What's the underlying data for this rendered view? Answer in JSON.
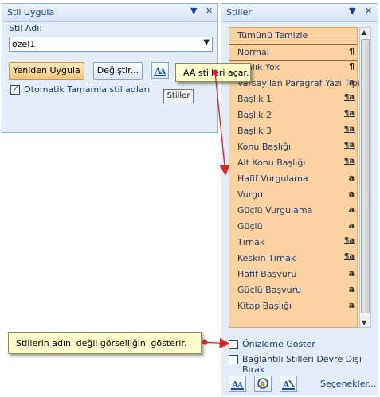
{
  "left_pane": {
    "title": "Stil Uygula",
    "style_name_label": "Stil Adı:",
    "style_name_value": "özel1",
    "reapply_button": "Yeniden Uygula",
    "modify_button": "Değiştir...",
    "autocomplete_label": "Otomatik Tamamla stil adları",
    "autocomplete_checked": true,
    "tooltip": "Stiller"
  },
  "right_pane": {
    "title": "Stiller",
    "styles": [
      {
        "label": "Tümünü Temizle",
        "mark": ""
      },
      {
        "label": "Normal",
        "mark": "¶"
      },
      {
        "label": "Aralık Yok",
        "mark": "¶"
      },
      {
        "label": "Varsayılan Paragraf Yazı Tipi",
        "mark": "a"
      },
      {
        "label": "Başlık 1",
        "mark": "¶a"
      },
      {
        "label": "Başlık 2",
        "mark": "¶a"
      },
      {
        "label": "Başlık 3",
        "mark": "¶a"
      },
      {
        "label": "Konu Başlığı",
        "mark": "¶a"
      },
      {
        "label": "Alt Konu Başlığı",
        "mark": "¶a"
      },
      {
        "label": "Hafif Vurgulama",
        "mark": "a"
      },
      {
        "label": "Vurgu",
        "mark": "a"
      },
      {
        "label": "Güçlü Vurgulama",
        "mark": "a"
      },
      {
        "label": "Güçlü",
        "mark": "a"
      },
      {
        "label": "Tırnak",
        "mark": "¶a"
      },
      {
        "label": "Keskin Tırnak",
        "mark": "¶a"
      },
      {
        "label": "Hafif Başvuru",
        "mark": "a"
      },
      {
        "label": "Güçlü Başvuru",
        "mark": "a"
      },
      {
        "label": "Kitap Başlığı",
        "mark": "a"
      }
    ],
    "preview_label": "Önizleme Göster",
    "preview_checked": false,
    "linked_label": "Bağlantılı Stilleri Devre Dışı Bırak",
    "linked_checked": false,
    "options_link": "Seçenekler..."
  },
  "callouts": {
    "top": "AA stilleri açar.",
    "bottom": "Stillerin adını değil görselliğini gösterir."
  },
  "colors": {
    "pane_bg": "#e3ecf7",
    "list_bg": "#fad3a0",
    "callout_bg": "#ffffcc",
    "arrow": "#e02020"
  }
}
